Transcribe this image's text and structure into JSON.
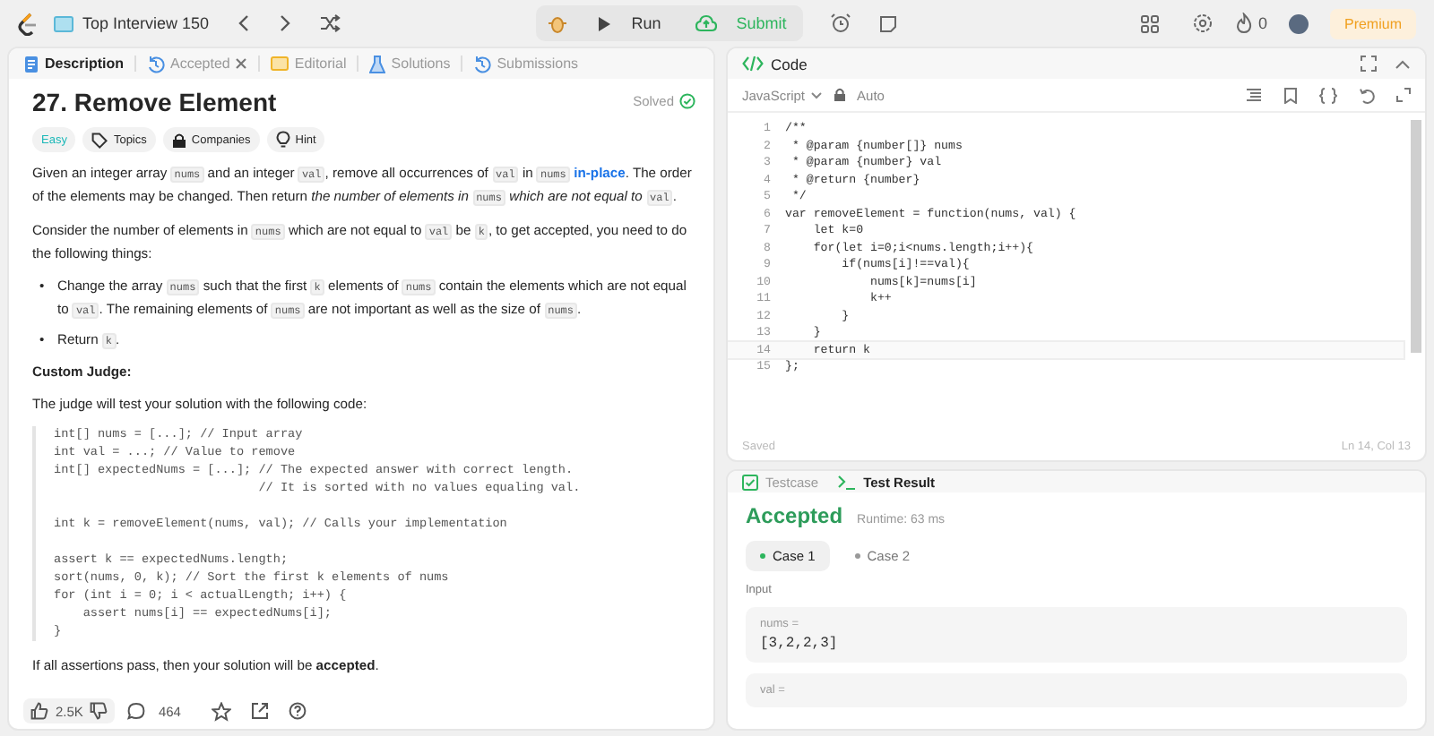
{
  "topbar": {
    "list_title": "Top Interview 150",
    "run": "Run",
    "submit": "Submit",
    "streak": "0",
    "premium": "Premium"
  },
  "desc_tabs": [
    {
      "kind": "description",
      "label": "Description",
      "selected": true,
      "closable": false
    },
    {
      "kind": "accepted",
      "label": "Accepted",
      "selected": false,
      "closable": true
    },
    {
      "kind": "editorial",
      "label": "Editorial",
      "selected": false,
      "closable": false
    },
    {
      "kind": "solutions",
      "label": "Solutions",
      "selected": false,
      "closable": false
    },
    {
      "kind": "submissions",
      "label": "Submissions",
      "selected": false,
      "closable": false
    }
  ],
  "problem": {
    "title": "27. Remove Element",
    "status": "Solved",
    "difficulty": "Easy",
    "tags": [
      {
        "kind": "topics",
        "label": "Topics"
      },
      {
        "kind": "companies",
        "label": "Companies"
      },
      {
        "kind": "hint",
        "label": "Hint"
      }
    ],
    "paragraphs": [
      [
        {
          "kind": "text",
          "text": "Given an integer array "
        },
        {
          "kind": "code",
          "text": "nums"
        },
        {
          "kind": "text",
          "text": " and an integer "
        },
        {
          "kind": "code",
          "text": "val"
        },
        {
          "kind": "text",
          "text": ", remove all occurrences of "
        },
        {
          "kind": "code",
          "text": "val"
        },
        {
          "kind": "text",
          "text": " in "
        },
        {
          "kind": "code",
          "text": "nums"
        },
        {
          "kind": "link",
          "text": "in-place"
        },
        {
          "kind": "text",
          "text": ". The order of the elements may be changed. Then return "
        },
        {
          "kind": "italic",
          "text": "the number of elements in "
        },
        {
          "kind": "code",
          "text": "nums"
        },
        {
          "kind": "italic",
          "text": " which are not equal to "
        },
        {
          "kind": "code",
          "text": "val"
        },
        {
          "kind": "text",
          "text": "."
        }
      ],
      [
        {
          "kind": "text",
          "text": "Consider the number of elements in "
        },
        {
          "kind": "code",
          "text": "nums"
        },
        {
          "kind": "text",
          "text": " which are not equal to "
        },
        {
          "kind": "code",
          "text": "val"
        },
        {
          "kind": "text",
          "text": " be "
        },
        {
          "kind": "code",
          "text": "k"
        },
        {
          "kind": "text",
          "text": ", to get accepted, you need to do the following things:"
        }
      ]
    ],
    "bullets": [
      {
        "marker": "•",
        "segments": [
          {
            "kind": "text",
            "text": "Change the array "
          },
          {
            "kind": "code",
            "text": "nums"
          },
          {
            "kind": "text",
            "text": " such that the first "
          },
          {
            "kind": "code",
            "text": "k"
          },
          {
            "kind": "text",
            "text": " elements of "
          },
          {
            "kind": "code",
            "text": "nums"
          },
          {
            "kind": "text",
            "text": " contain the elements which are not equal to "
          },
          {
            "kind": "code",
            "text": "val"
          },
          {
            "kind": "text",
            "text": ". The remaining elements of "
          },
          {
            "kind": "code",
            "text": "nums"
          },
          {
            "kind": "text",
            "text": " are not important as well as the size of "
          },
          {
            "kind": "code",
            "text": "nums"
          },
          {
            "kind": "text",
            "text": "."
          }
        ]
      },
      {
        "marker": "•",
        "segments": [
          {
            "kind": "text",
            "text": "Return "
          },
          {
            "kind": "code",
            "text": "k"
          },
          {
            "kind": "text",
            "text": "."
          }
        ]
      }
    ],
    "judge_heading": "Custom Judge:",
    "judge_intro": "The judge will test your solution with the following code:",
    "judge_code": "int[] nums = [...]; // Input array\nint val = ...; // Value to remove\nint[] expectedNums = [...]; // The expected answer with correct length.\n                            // It is sorted with no values equaling val.\n\nint k = removeElement(nums, val); // Calls your implementation\n\nassert k == expectedNums.length;\nsort(nums, 0, k); // Sort the first k elements of nums\nfor (int i = 0; i < actualLength; i++) {\n    assert nums[i] == expectedNums[i];\n}",
    "closing": [
      {
        "kind": "text",
        "text": "If all assertions pass, then your solution will be "
      },
      {
        "kind": "bold",
        "text": "accepted"
      },
      {
        "kind": "text",
        "text": "."
      }
    ],
    "likes": "2.5K",
    "comments": "464"
  },
  "code_panel": {
    "title": "Code",
    "language": "JavaScript",
    "mode": "Auto",
    "lines": [
      {
        "n": "1",
        "code": "/**",
        "current": false
      },
      {
        "n": "2",
        "code": " * @param {number[]} nums",
        "current": false
      },
      {
        "n": "3",
        "code": " * @param {number} val",
        "current": false
      },
      {
        "n": "4",
        "code": " * @return {number}",
        "current": false
      },
      {
        "n": "5",
        "code": " */",
        "current": false
      },
      {
        "n": "6",
        "code": "var removeElement = function(nums, val) {",
        "current": false
      },
      {
        "n": "7",
        "code": "    let k=0",
        "current": false
      },
      {
        "n": "8",
        "code": "    for(let i=0;i<nums.length;i++){",
        "current": false
      },
      {
        "n": "9",
        "code": "        if(nums[i]!==val){",
        "current": false
      },
      {
        "n": "10",
        "code": "            nums[k]=nums[i]",
        "current": false
      },
      {
        "n": "11",
        "code": "            k++",
        "current": false
      },
      {
        "n": "12",
        "code": "        }",
        "current": false
      },
      {
        "n": "13",
        "code": "    }",
        "current": false
      },
      {
        "n": "14",
        "code": "    return k",
        "current": true
      },
      {
        "n": "15",
        "code": "};",
        "current": false
      }
    ],
    "saved": "Saved",
    "cursor": "Ln 14, Col 13"
  },
  "result_panel": {
    "tabs": [
      {
        "kind": "testcase",
        "label": "Testcase",
        "selected": false
      },
      {
        "kind": "result",
        "label": "Test Result",
        "selected": true
      }
    ],
    "verdict": "Accepted",
    "runtime": "Runtime: 63 ms",
    "cases": [
      {
        "label": "Case 1",
        "selected": true
      },
      {
        "label": "Case 2",
        "selected": false
      }
    ],
    "input_label": "Input",
    "inputs": [
      {
        "name": "nums =",
        "value": "[3,2,2,3]"
      },
      {
        "name": "val ="
      }
    ]
  }
}
